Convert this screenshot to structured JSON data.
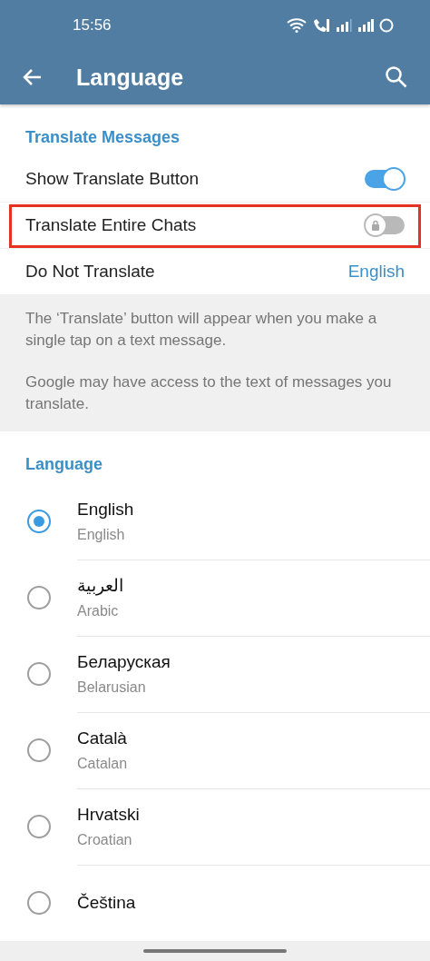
{
  "status_bar": {
    "time": "15:56"
  },
  "app_bar": {
    "title": "Language"
  },
  "translate_section": {
    "title": "Translate Messages",
    "rows": [
      {
        "kind": "toggle",
        "label": "Show Translate Button",
        "on": true,
        "locked": false,
        "highlighted": false
      },
      {
        "kind": "toggle",
        "label": "Translate Entire Chats",
        "on": false,
        "locked": true,
        "highlighted": true
      },
      {
        "kind": "value",
        "label": "Do Not Translate",
        "value": "English",
        "highlighted": false
      }
    ]
  },
  "info": [
    "The ‘Translate’ button will appear when you make a single tap on a text message.",
    "Google may have access to the text of messages you translate."
  ],
  "language_section": {
    "title": "Language",
    "items": [
      {
        "name": "English",
        "subtitle": "English",
        "selected": true
      },
      {
        "name": "العربية",
        "subtitle": "Arabic",
        "selected": false
      },
      {
        "name": "Беларуская",
        "subtitle": "Belarusian",
        "selected": false
      },
      {
        "name": "Català",
        "subtitle": "Catalan",
        "selected": false
      },
      {
        "name": "Hrvatski",
        "subtitle": "Croatian",
        "selected": false
      },
      {
        "name": "Čeština",
        "selected": false
      }
    ]
  }
}
